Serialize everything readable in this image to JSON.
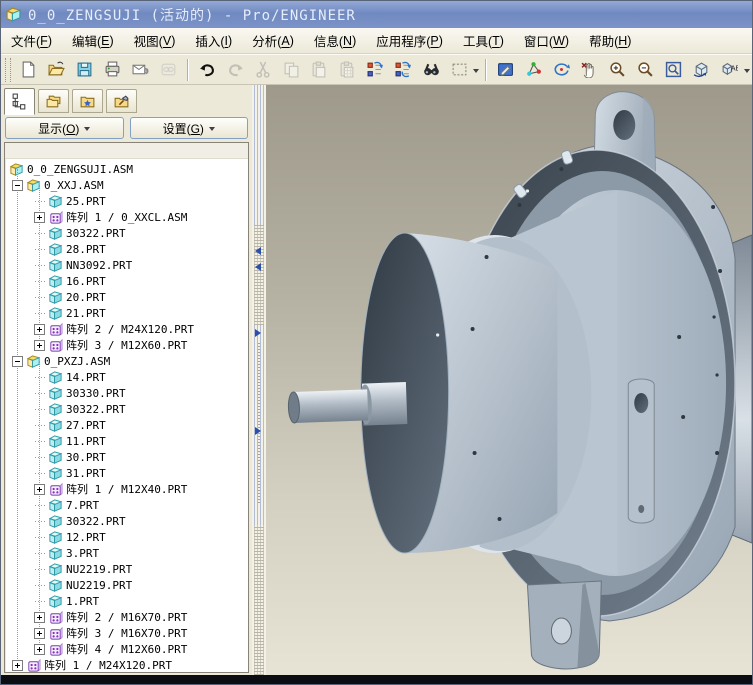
{
  "window": {
    "title": "0_0_ZENGSUJI (活动的) - Pro/ENGINEER"
  },
  "menu": {
    "items": [
      {
        "name": "file",
        "label": "文件(F)"
      },
      {
        "name": "edit",
        "label": "编辑(E)"
      },
      {
        "name": "view",
        "label": "视图(V)"
      },
      {
        "name": "insert",
        "label": "插入(I)"
      },
      {
        "name": "analysis",
        "label": "分析(A)"
      },
      {
        "name": "info",
        "label": "信息(N)"
      },
      {
        "name": "applications",
        "label": "应用程序(P)"
      },
      {
        "name": "tools",
        "label": "工具(T)"
      },
      {
        "name": "window",
        "label": "窗口(W)"
      },
      {
        "name": "help",
        "label": "帮助(H)"
      }
    ]
  },
  "toolbar": {
    "items": [
      {
        "name": "new-file"
      },
      {
        "name": "open"
      },
      {
        "name": "save"
      },
      {
        "name": "print"
      },
      {
        "name": "send-email"
      },
      {
        "name": "email-link",
        "disabled": true
      },
      {
        "sep": true
      },
      {
        "name": "undo"
      },
      {
        "name": "redo",
        "disabled": true
      },
      {
        "name": "cut",
        "disabled": true
      },
      {
        "name": "copy",
        "disabled": true
      },
      {
        "name": "paste",
        "disabled": true
      },
      {
        "name": "paste-special",
        "disabled": true
      },
      {
        "name": "regenerate"
      },
      {
        "name": "custom-regenerate"
      },
      {
        "name": "find"
      },
      {
        "name": "select-box",
        "dropdown": true
      },
      {
        "sep": true
      },
      {
        "name": "repaint"
      },
      {
        "name": "datum-display"
      },
      {
        "name": "spin-center"
      },
      {
        "name": "pan-zoom"
      },
      {
        "name": "zoom-in"
      },
      {
        "name": "zoom-out"
      },
      {
        "name": "refit"
      },
      {
        "name": "reorient"
      },
      {
        "name": "saved-views",
        "dropdown": true
      }
    ]
  },
  "panel": {
    "tabs": [
      {
        "name": "model-tree-tab",
        "icon": "model-tree",
        "active": true
      },
      {
        "name": "folder-browser-tab",
        "icon": "folders",
        "active": false
      },
      {
        "name": "favorites-tab",
        "icon": "favorites",
        "active": false
      },
      {
        "name": "connections-tab",
        "icon": "history",
        "active": false
      }
    ],
    "show_button": {
      "label": "显示(O)"
    },
    "settings_button": {
      "label": "设置(G)"
    },
    "tree": [
      {
        "label": "0_0_ZENGSUJI.ASM",
        "level": 0,
        "icon": "asm",
        "expander": "none"
      },
      {
        "label": "0_XXJ.ASM",
        "level": 1,
        "icon": "asm",
        "expander": "minus"
      },
      {
        "label": "25.PRT",
        "level": 2,
        "icon": "part",
        "expander": "none"
      },
      {
        "label": "阵列 1 / 0_XXCL.ASM",
        "level": 2,
        "icon": "pattern",
        "expander": "plus"
      },
      {
        "label": "30322.PRT",
        "level": 2,
        "icon": "part",
        "expander": "none"
      },
      {
        "label": "28.PRT",
        "level": 2,
        "icon": "part",
        "expander": "none"
      },
      {
        "label": "NN3092.PRT",
        "level": 2,
        "icon": "part",
        "expander": "none"
      },
      {
        "label": "16.PRT",
        "level": 2,
        "icon": "part",
        "expander": "none"
      },
      {
        "label": "20.PRT",
        "level": 2,
        "icon": "part",
        "expander": "none"
      },
      {
        "label": "21.PRT",
        "level": 2,
        "icon": "part",
        "expander": "none"
      },
      {
        "label": "阵列 2 / M24X120.PRT",
        "level": 2,
        "icon": "pattern",
        "expander": "plus"
      },
      {
        "label": "阵列 3 / M12X60.PRT",
        "level": 2,
        "icon": "pattern",
        "expander": "plus"
      },
      {
        "label": "0_PXZJ.ASM",
        "level": 1,
        "icon": "asm",
        "expander": "minus"
      },
      {
        "label": "14.PRT",
        "level": 2,
        "icon": "part",
        "expander": "none"
      },
      {
        "label": "30330.PRT",
        "level": 2,
        "icon": "part",
        "expander": "none"
      },
      {
        "label": "30322.PRT",
        "level": 2,
        "icon": "part",
        "expander": "none"
      },
      {
        "label": "27.PRT",
        "level": 2,
        "icon": "part",
        "expander": "none"
      },
      {
        "label": "11.PRT",
        "level": 2,
        "icon": "part",
        "expander": "none"
      },
      {
        "label": "30.PRT",
        "level": 2,
        "icon": "part",
        "expander": "none"
      },
      {
        "label": "31.PRT",
        "level": 2,
        "icon": "part",
        "expander": "none"
      },
      {
        "label": "阵列 1 / M12X40.PRT",
        "level": 2,
        "icon": "pattern",
        "expander": "plus"
      },
      {
        "label": "7.PRT",
        "level": 2,
        "icon": "part",
        "expander": "none"
      },
      {
        "label": "30322.PRT",
        "level": 2,
        "icon": "part",
        "expander": "none"
      },
      {
        "label": "12.PRT",
        "level": 2,
        "icon": "part",
        "expander": "none"
      },
      {
        "label": "3.PRT",
        "level": 2,
        "icon": "part",
        "expander": "none"
      },
      {
        "label": "NU2219.PRT",
        "level": 2,
        "icon": "part",
        "expander": "none"
      },
      {
        "label": "NU2219.PRT",
        "level": 2,
        "icon": "part",
        "expander": "none"
      },
      {
        "label": "1.PRT",
        "level": 2,
        "icon": "part",
        "expander": "none"
      },
      {
        "label": "阵列 2 / M16X70.PRT",
        "level": 2,
        "icon": "pattern",
        "expander": "plus"
      },
      {
        "label": "阵列 3 / M16X70.PRT",
        "level": 2,
        "icon": "pattern",
        "expander": "plus"
      },
      {
        "label": "阵列 4 / M12X60.PRT",
        "level": 2,
        "icon": "pattern",
        "expander": "plus"
      },
      {
        "label": "阵列 1 / M24X120.PRT",
        "level": 1,
        "icon": "pattern",
        "expander": "plus"
      }
    ]
  },
  "viewport": {
    "content": "gear-reducer-assembly-3d-model",
    "background_top": "#9e998b",
    "background_bottom": "#e7e4d6",
    "model_light": "#d7dfe7",
    "model_mid": "#9aa8b6",
    "model_dark": "#3c4650"
  },
  "colors": {
    "titlebar": "#7b90c4",
    "chrome": "#ece9d8",
    "tree_background": "#ffffff",
    "splitter_accent": "#2c4fa8"
  }
}
